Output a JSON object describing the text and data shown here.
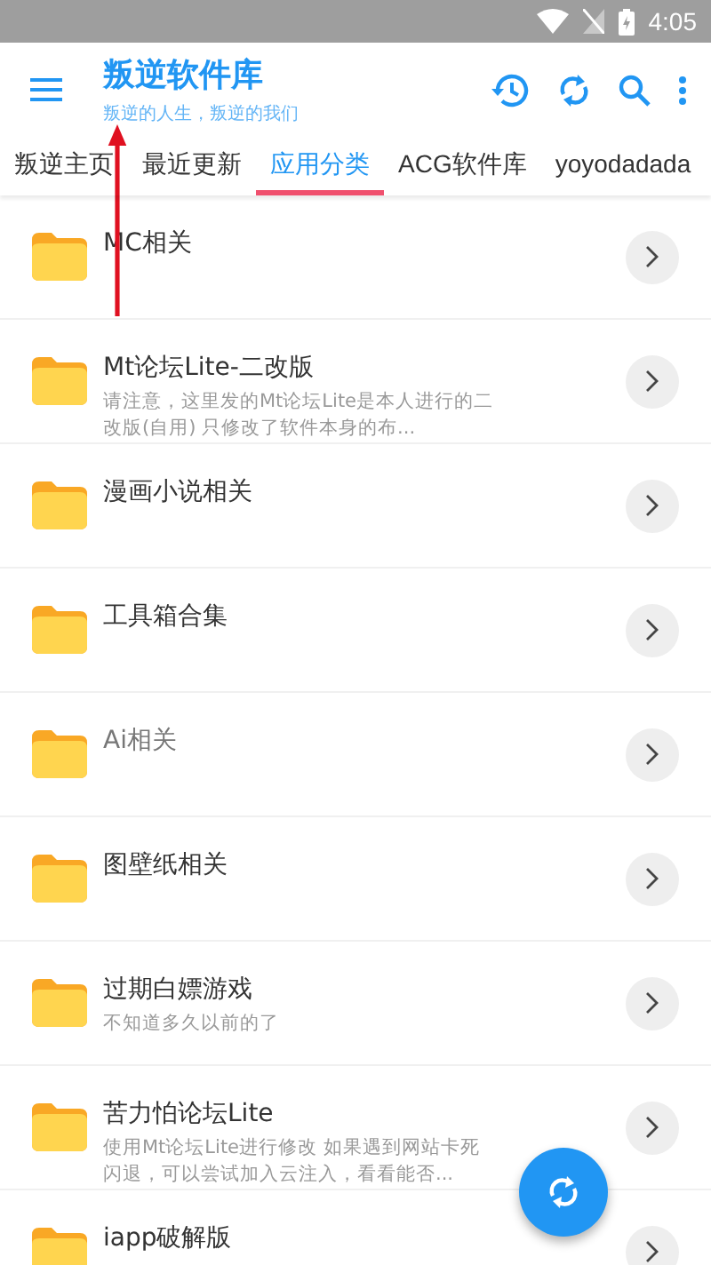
{
  "status_bar": {
    "time": "4:05"
  },
  "app_bar": {
    "title": "叛逆软件库",
    "subtitle": "叛逆的人生，叛逆的我们"
  },
  "tabs": [
    {
      "label": "叛逆主页",
      "selected": false
    },
    {
      "label": "最近更新",
      "selected": false
    },
    {
      "label": "应用分类",
      "selected": true
    },
    {
      "label": "ACG软件库",
      "selected": false
    },
    {
      "label": "yoyodadada",
      "selected": false
    }
  ],
  "folders": [
    {
      "title": "MC相关",
      "dimmed": false
    },
    {
      "title": "Mt论坛Lite-二改版",
      "description": "请注意，这里发的Mt论坛Lite是本人进行的二改版(自用) 只修改了软件本身的布...",
      "dimmed": false
    },
    {
      "title": "漫画小说相关",
      "dimmed": false
    },
    {
      "title": "工具箱合集",
      "dimmed": false
    },
    {
      "title": "Ai相关",
      "dimmed": true
    },
    {
      "title": "图壁纸相关",
      "dimmed": false
    },
    {
      "title": "过期白嫖游戏",
      "description": "不知道多久以前的了",
      "dimmed": false
    },
    {
      "title": "苦力怕论坛Lite",
      "description": "使用Mt论坛Lite进行修改 如果遇到网站卡死闪退，可以尝试加入云注入，看看能否...",
      "dimmed": false
    },
    {
      "title": "iapp破解版",
      "dimmed": false
    }
  ]
}
